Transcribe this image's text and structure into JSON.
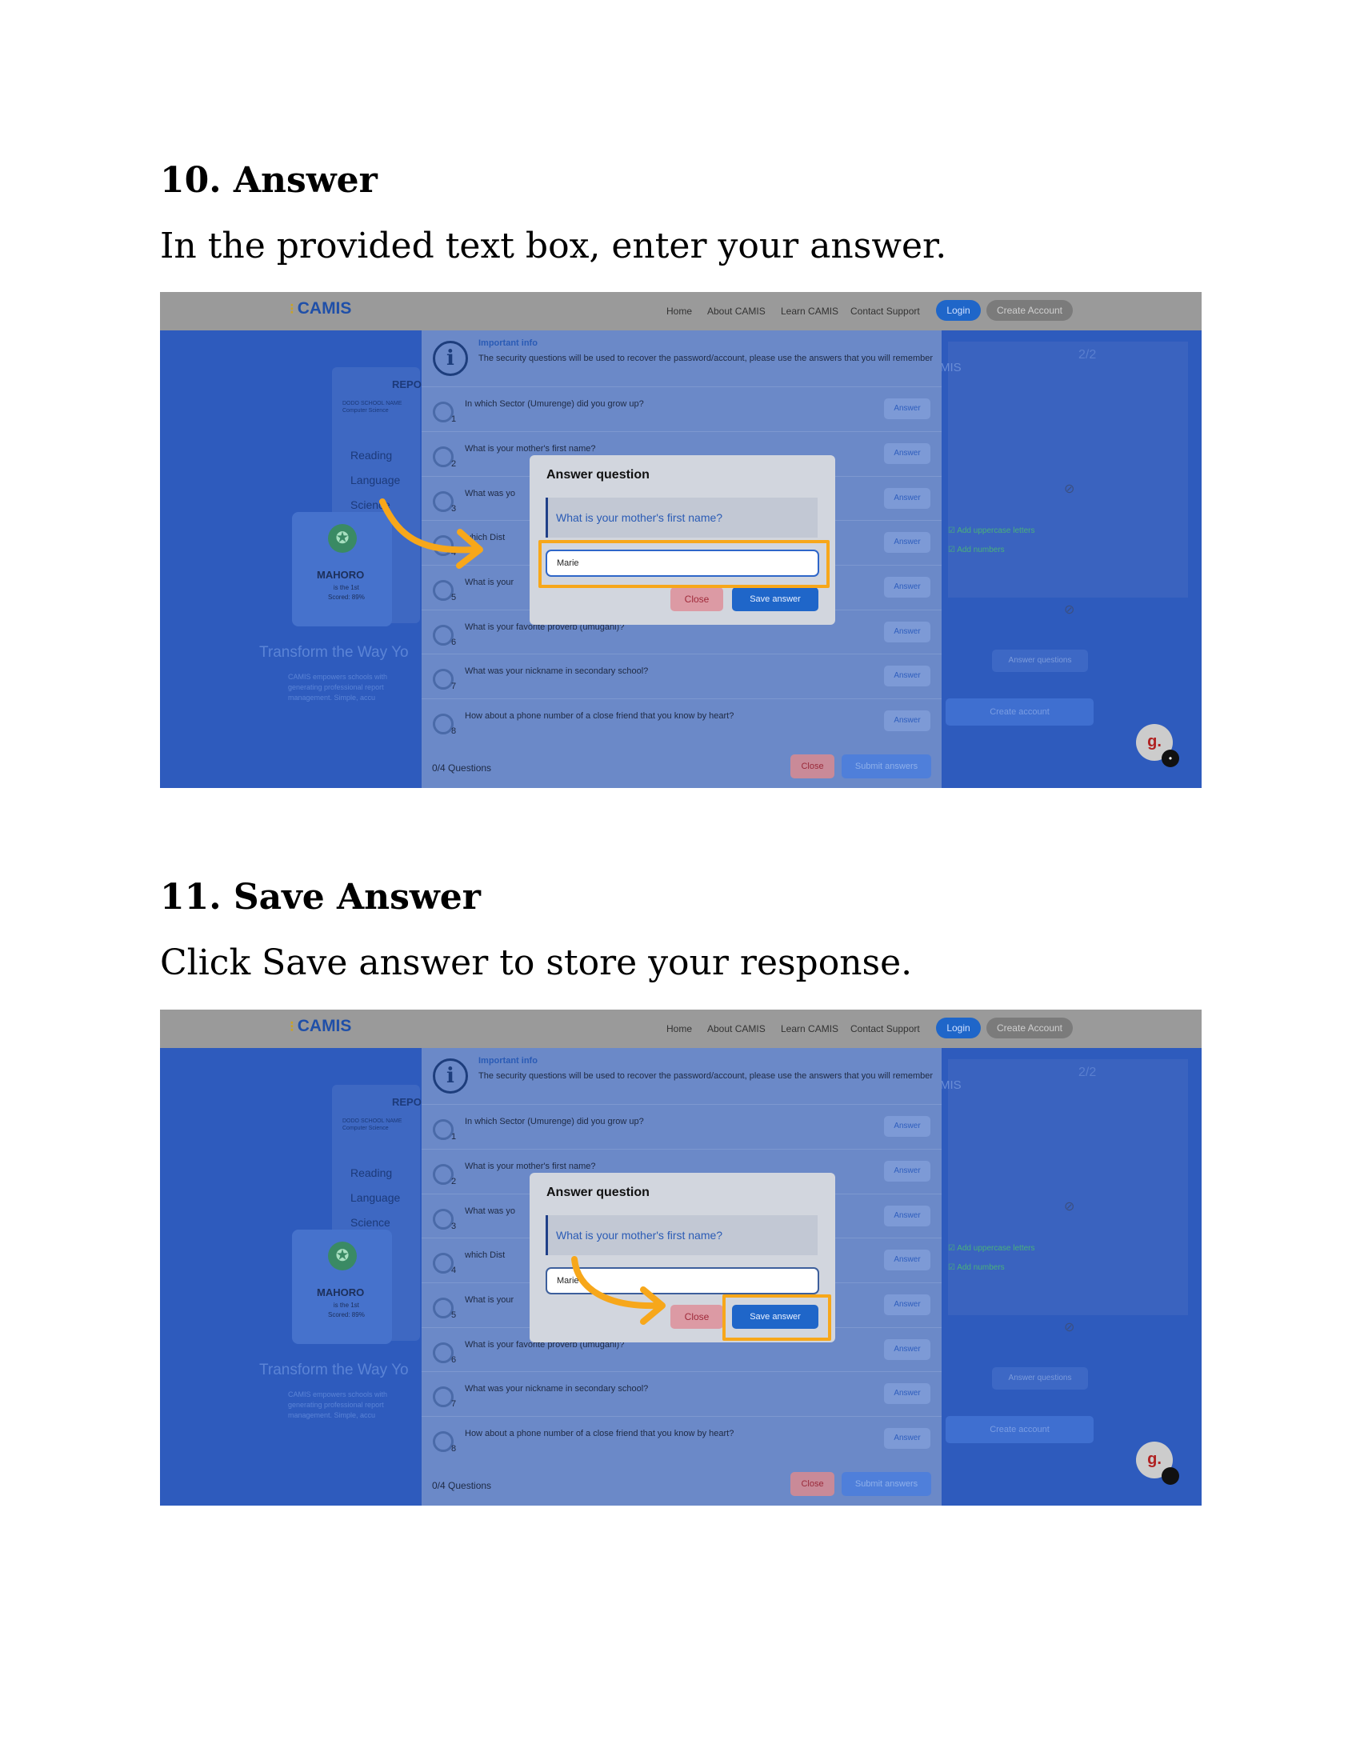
{
  "steps": [
    {
      "title": "10. Answer",
      "description": "In the provided text box, enter your answer.",
      "input_value": "Marie"
    },
    {
      "title": "11. Save Answer",
      "description": "Click Save answer to store your response.",
      "input_value": "Marie"
    }
  ],
  "ui": {
    "logo": "CAMIS",
    "nav": {
      "home": "Home",
      "about": "About CAMIS",
      "learn": "Learn CAMIS",
      "contact": "Contact Support",
      "login": "Login",
      "create_account": "Create Account"
    },
    "info": {
      "title": "Important info",
      "text": "The security questions will be used to recover the password/account, please use the answers that you will remember"
    },
    "questions": [
      "In which Sector (Umurenge) did you grow up?",
      "What is your mother's first name?",
      "What was yo",
      "which Dist",
      "What is your",
      "What is your favorite proverb (umugani)?",
      "What was your nickname in secondary school?",
      "How about a phone number of a close friend that you know by heart?"
    ],
    "question_numbers": [
      "1",
      "2",
      "3",
      "4",
      "5",
      "6",
      "7",
      "8"
    ],
    "answer_label": "Answer",
    "footer_count": "0/4 Questions",
    "close": "Close",
    "submit": "Submit answers",
    "modal": {
      "title": "Answer question",
      "question": "What is your mother's first name?",
      "close": "Close",
      "save": "Save answer"
    },
    "background": {
      "report": "REPO",
      "school": "DODO SCHOOL NAME",
      "school_sub": "Computer Science",
      "subjects": [
        "Reading",
        "Language",
        "Science"
      ],
      "student": "MAHORO",
      "student_sub1": "is the 1st",
      "student_sub2": "Scored: 89%",
      "tagline": "Transform the Way Yo",
      "desc1": "CAMIS empowers schools with",
      "desc2": "generating professional report",
      "desc3": "management. Simple, accu",
      "right_num": "2/2",
      "right_mis": "MIS",
      "req1": "Add uppercase letters",
      "req2": "Add numbers",
      "answer_questions": "Answer questions",
      "create_account": "Create account",
      "avatar": "g."
    }
  },
  "colors": {
    "highlight": "#f7a71a",
    "primary": "#1f66c9"
  }
}
